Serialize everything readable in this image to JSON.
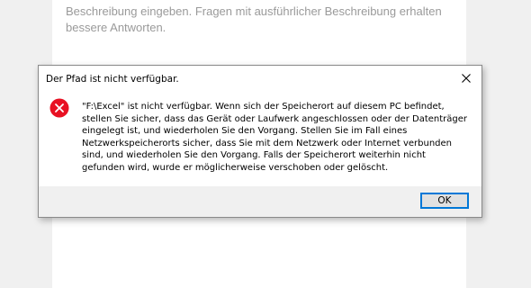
{
  "background": {
    "hint_text": "Beschreibung eingeben. Fragen mit ausführlicher Beschreibung erhalten bessere Antworten."
  },
  "dialog": {
    "title": "Der Pfad ist nicht verfügbar.",
    "message": "\"F:\\Excel\" ist nicht verfügbar. Wenn sich der Speicherort auf diesem PC befindet, stellen Sie sicher, dass das Gerät oder Laufwerk angeschlossen oder der Datenträger eingelegt ist, und wiederholen Sie den Vorgang. Stellen Sie im Fall eines Netzwerkspeicherorts sicher, dass Sie mit dem Netzwerk oder Internet verbunden sind, und wiederholen Sie den Vorgang. Falls der Speicherort weiterhin nicht gefunden wird, wurde er möglicherweise verschoben oder gelöscht.",
    "ok_label": "OK",
    "icon": "error-icon",
    "close_icon": "close-icon"
  },
  "colors": {
    "error_red": "#e81123",
    "accent_blue": "#0078d7"
  }
}
